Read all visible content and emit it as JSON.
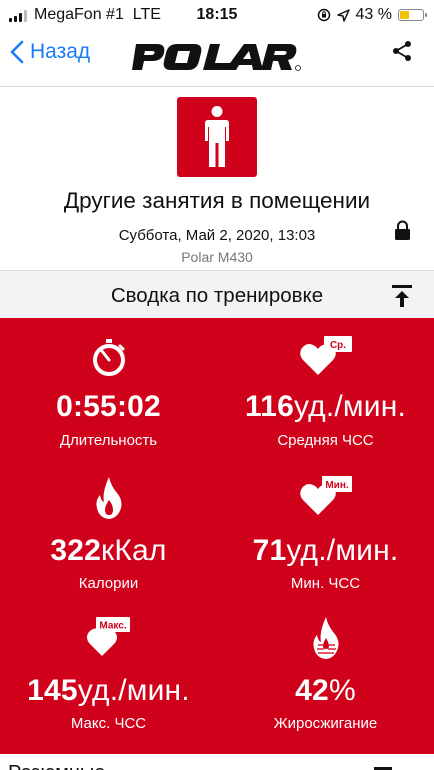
{
  "status_bar": {
    "carrier": "MegaFon #1",
    "network": "LTE",
    "time": "18:15",
    "battery": "43 %",
    "battery_level": 0.43
  },
  "nav": {
    "back_label": "Назад",
    "logo_text": "POLAR"
  },
  "session": {
    "title": "Другие занятия в помещении",
    "datetime": "Суббота, Май 2, 2020, 13:03",
    "device": "Polar M430"
  },
  "summary": {
    "header": "Сводка по тренировке",
    "stats": [
      {
        "icon": "stopwatch-icon",
        "value": "0:55:02",
        "unit": "",
        "label": "Длительность"
      },
      {
        "icon": "heart-avg-icon",
        "badge": "Ср.",
        "value": "116",
        "unit": "уд./мин.",
        "label": "Средняя ЧСС"
      },
      {
        "icon": "flame-icon",
        "value": "322",
        "unit": "кКал",
        "label": "Калории"
      },
      {
        "icon": "heart-min-icon",
        "badge": "Мин.",
        "value": "71",
        "unit": "уд./мин.",
        "label": "Мин. ЧСС"
      },
      {
        "icon": "heart-max-icon",
        "badge": "Макс.",
        "value": "145",
        "unit": "уд./мин.",
        "label": "Макс. ЧСС"
      },
      {
        "icon": "fat-burn-icon",
        "value": "42",
        "unit": "%",
        "label": "Жиросжигание"
      }
    ]
  },
  "next_section": {
    "label": "Резюмные"
  },
  "colors": {
    "accent": "#d0021b",
    "link": "#1a7cf5"
  }
}
